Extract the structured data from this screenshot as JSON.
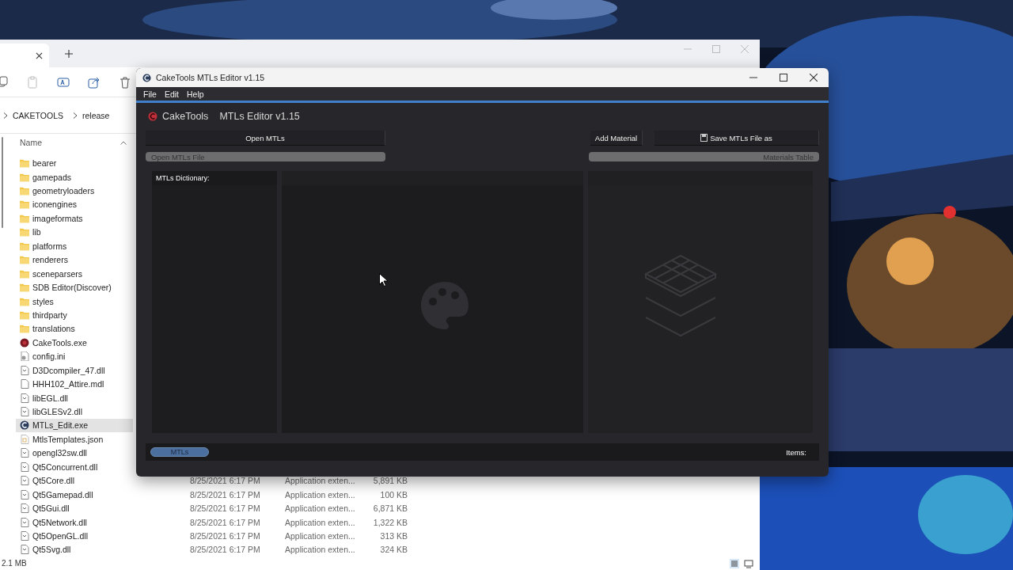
{
  "explorer": {
    "breadcrumb": [
      "CAKETOOLS",
      "release"
    ],
    "columns": [
      "Name"
    ],
    "files": [
      {
        "name": "bearer",
        "kind": "folder",
        "selected": false
      },
      {
        "name": "gamepads",
        "kind": "folder",
        "selected": false
      },
      {
        "name": "geometryloaders",
        "kind": "folder",
        "selected": false
      },
      {
        "name": "iconengines",
        "kind": "folder",
        "selected": false
      },
      {
        "name": "imageformats",
        "kind": "folder",
        "selected": false
      },
      {
        "name": "lib",
        "kind": "folder",
        "selected": false
      },
      {
        "name": "platforms",
        "kind": "folder",
        "selected": false
      },
      {
        "name": "renderers",
        "kind": "folder",
        "selected": false
      },
      {
        "name": "sceneparsers",
        "kind": "folder",
        "selected": false
      },
      {
        "name": "SDB Editor(Discover)",
        "kind": "folder",
        "selected": false
      },
      {
        "name": "styles",
        "kind": "folder",
        "selected": false
      },
      {
        "name": "thirdparty",
        "kind": "folder",
        "selected": false
      },
      {
        "name": "translations",
        "kind": "folder",
        "selected": false
      },
      {
        "name": "CakeTools.exe",
        "kind": "cake-app",
        "selected": false
      },
      {
        "name": "config.ini",
        "kind": "settings",
        "selected": false
      },
      {
        "name": "D3Dcompiler_47.dll",
        "kind": "dll",
        "selected": false
      },
      {
        "name": "HHH102_Attire.mdl",
        "kind": "blank",
        "selected": false
      },
      {
        "name": "libEGL.dll",
        "kind": "dll",
        "selected": false
      },
      {
        "name": "libGLESv2.dll",
        "kind": "dll",
        "selected": false
      },
      {
        "name": "MTLs_Edit.exe",
        "kind": "editor-app",
        "selected": true
      },
      {
        "name": "MtlsTemplates.json",
        "kind": "json",
        "selected": false
      },
      {
        "name": "opengl32sw.dll",
        "kind": "dll",
        "selected": false
      },
      {
        "name": "Qt5Concurrent.dll",
        "kind": "dll",
        "selected": false
      },
      {
        "name": "Qt5Core.dll",
        "kind": "dll",
        "selected": false,
        "date": "8/25/2021 6:17 PM",
        "type": "Application exten...",
        "size": "5,891 KB"
      },
      {
        "name": "Qt5Gamepad.dll",
        "kind": "dll",
        "selected": false,
        "date": "8/25/2021 6:17 PM",
        "type": "Application exten...",
        "size": "100 KB"
      },
      {
        "name": "Qt5Gui.dll",
        "kind": "dll",
        "selected": false,
        "date": "8/25/2021 6:17 PM",
        "type": "Application exten...",
        "size": "6,871 KB"
      },
      {
        "name": "Qt5Network.dll",
        "kind": "dll",
        "selected": false,
        "date": "8/25/2021 6:17 PM",
        "type": "Application exten...",
        "size": "1,322 KB"
      },
      {
        "name": "Qt5OpenGL.dll",
        "kind": "dll",
        "selected": false,
        "date": "8/25/2021 6:17 PM",
        "type": "Application exten...",
        "size": "313 KB"
      },
      {
        "name": "Qt5Svg.dll",
        "kind": "dll",
        "selected": false,
        "date": "8/25/2021 6:17 PM",
        "type": "Application exten...",
        "size": "324 KB"
      }
    ],
    "status": "2.1 MB"
  },
  "app": {
    "title": "CakeTools MTLs Editor v1.15",
    "menu": [
      "File",
      "Edit",
      "Help"
    ],
    "brand": "CakeTools",
    "heading": "MTLs Editor v1.15",
    "open_button": "Open MTLs",
    "add_button": "Add Material",
    "save_button": "Save MTLs File as",
    "open_file_label": "Open MTLs File",
    "materials_label": "Materials Table",
    "dictionary_label": "MTLs Dictionary:",
    "tab": {
      "label": "MTLs",
      "selected": true
    },
    "items_label": "Items:"
  }
}
